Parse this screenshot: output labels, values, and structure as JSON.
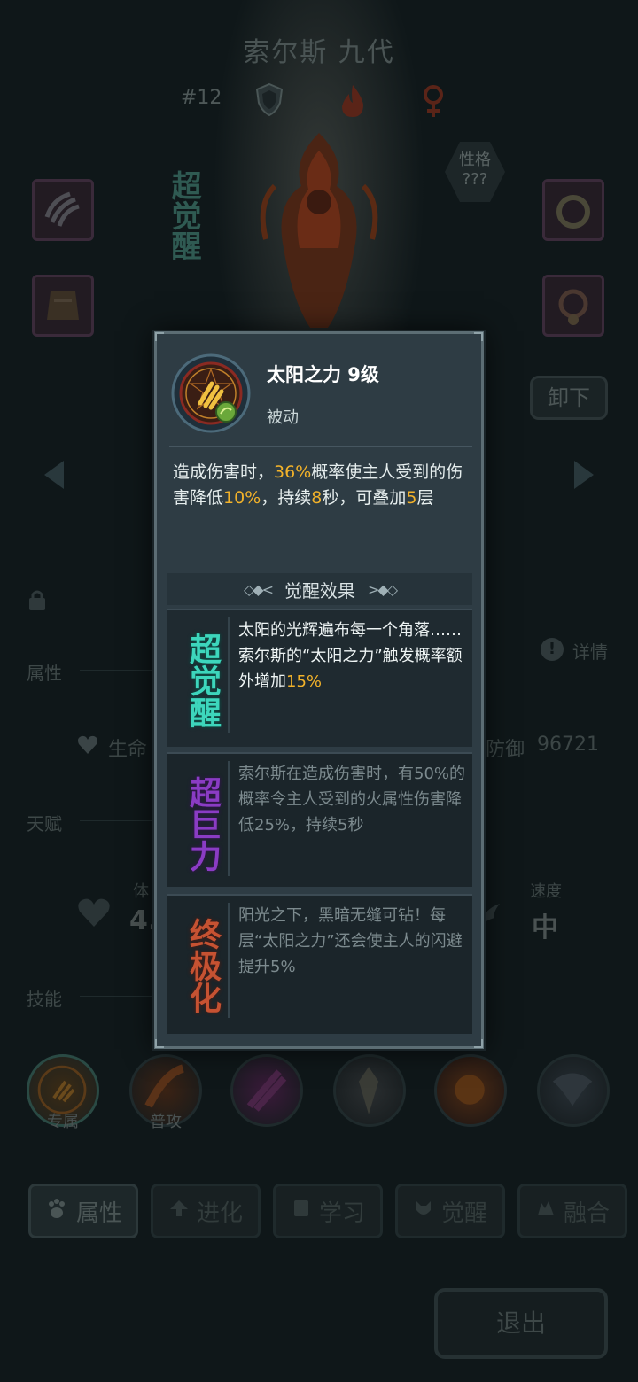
{
  "hero": {
    "name": "索尔斯 九代",
    "number": "#12",
    "nature_label": "性格",
    "nature_value": "???",
    "awaken_tag": "超觉醒",
    "unequip_label": "卸下"
  },
  "panel": {
    "attr_label": "属性",
    "detail_label": "详情",
    "life_label": "生命",
    "defense_label": "防御",
    "defense_value": "96721",
    "talent_label": "天赋",
    "body_label": "体",
    "body_value_partial": "4.",
    "speed_label": "速度",
    "speed_value": "中",
    "skill_label": "技能"
  },
  "skills": [
    {
      "name": "exclusive",
      "label": "专属"
    },
    {
      "name": "normal",
      "label": "普攻"
    },
    {
      "name": "skill3",
      "label": ""
    },
    {
      "name": "skill4",
      "label": ""
    },
    {
      "name": "skill5",
      "label": ""
    },
    {
      "name": "skill6",
      "label": ""
    }
  ],
  "tabs": {
    "attr": "属性",
    "evolve": "进化",
    "learn": "学习",
    "awaken": "觉醒",
    "fuse": "融合"
  },
  "exit_label": "退出",
  "popup": {
    "title": "太阳之力 9级",
    "type": "被动",
    "desc": {
      "p1": "造成伤害时，",
      "v1": "36%",
      "p2": "概率使主人受到的伤害降低",
      "v2": "10%",
      "p3": "，持续",
      "v3": "8",
      "p4": "秒，可叠加",
      "v4": "5",
      "p5": "层"
    },
    "awaken_header": "觉醒效果",
    "effects": [
      {
        "badge": "超觉醒",
        "text_a": "太阳的光辉遍布每一个角落……索尔斯的“太阳之力”触发概率额外增加",
        "text_hl": "15%",
        "active": true,
        "color": "#2fb6a0"
      },
      {
        "badge": "超巨力",
        "text_a": "索尔斯在造成伤害时，有50%的概率令主人受到的火属性伤害降低25%，持续5秒",
        "text_hl": "",
        "active": false,
        "color": "#7a3ba8"
      },
      {
        "badge": "终极化",
        "text_a": "阳光之下，黑暗无缝可钻！每层“太阳之力”还会使主人的闪避提升5%",
        "text_hl": "",
        "active": false,
        "color": "#b5452a"
      }
    ]
  },
  "colors": {
    "highlight": "#f2b22a",
    "popup_bg": "#2e3c44",
    "awaken_teal": "#2fb6a0"
  }
}
